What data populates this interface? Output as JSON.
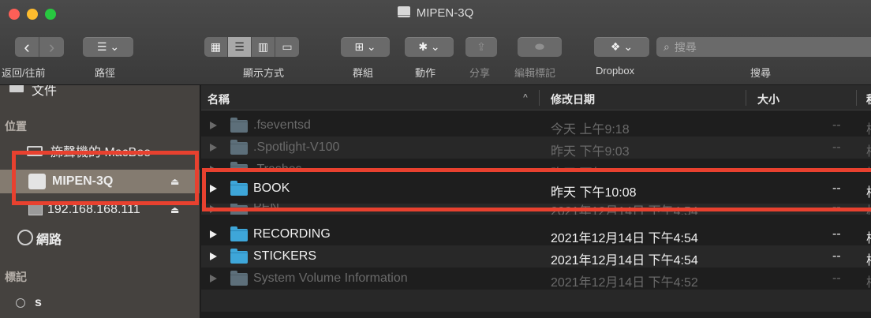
{
  "window": {
    "title": "MIPEN-3Q"
  },
  "toolbar": {
    "nav_back": "‹",
    "nav_forward": "›",
    "path_button": "☰ ⌄",
    "view_icon": "▦",
    "view_list": "☰",
    "view_columns": "▥",
    "view_gallery": "▭",
    "group_button": "⊞ ⌄",
    "action_button": "✱ ⌄",
    "share_icon": "⇪",
    "tags_icon": "⬬",
    "dropbox_button": "❖ ⌄",
    "search_icon": "⌕",
    "search_placeholder": "搜尋",
    "labels": {
      "back_forward": "返回/往前",
      "path": "路徑",
      "view": "顯示方式",
      "group": "群組",
      "action": "動作",
      "share": "分享",
      "edit_tags": "編輯標記",
      "dropbox": "Dropbox",
      "search": "搜尋"
    }
  },
  "sidebar": {
    "partial_top_item": "文件",
    "locations_header": "位置",
    "locations": [
      {
        "label": "旆聲機的 MacBoo",
        "eject": ""
      },
      {
        "label": "MIPEN-3Q",
        "eject": "⏏"
      },
      {
        "label": "192.168.168.111",
        "eject": "⏏"
      },
      {
        "label": "網路",
        "eject": ""
      }
    ],
    "tags_header": "標記",
    "tags": [
      {
        "label": "s"
      }
    ]
  },
  "file_list": {
    "columns": {
      "name": "名稱",
      "sort_indicator": "^",
      "date_modified": "修改日期",
      "size": "大小",
      "kind": "種"
    },
    "rows": [
      {
        "name": ".fseventsd",
        "date": "今天 上午9:18",
        "size": "--",
        "kind": "檔"
      },
      {
        "name": ".Spotlight-V100",
        "date": "昨天 下午9:03",
        "size": "--",
        "kind": "檔"
      },
      {
        "name": ".Trashes",
        "date": "昨天 下午9:31",
        "size": "--",
        "kind": "檔"
      },
      {
        "name": "BOOK",
        "date": "昨天 下午10:08",
        "size": "--",
        "kind": "檔"
      },
      {
        "name": "PEN",
        "date": "2021年12月14日 下午4:54",
        "size": "--",
        "kind": "檔"
      },
      {
        "name": "RECORDING",
        "date": "2021年12月14日 下午4:54",
        "size": "--",
        "kind": "檔"
      },
      {
        "name": "STICKERS",
        "date": "2021年12月14日 下午4:54",
        "size": "--",
        "kind": "檔"
      },
      {
        "name": "System Volume Information",
        "date": "2021年12月14日 下午4:52",
        "size": "--",
        "kind": "檔"
      }
    ]
  },
  "colors": {
    "highlight": "#e8412f",
    "folder": "#3ea6d9",
    "sidebar_selected": "#847b70"
  }
}
